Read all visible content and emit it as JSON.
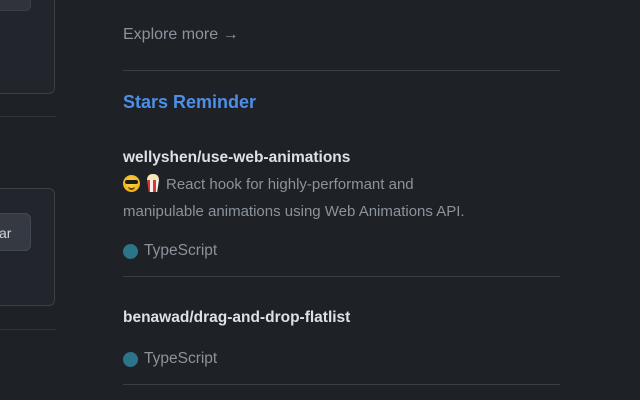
{
  "left": {
    "button_partial_label": "ar"
  },
  "main": {
    "explore_label": "Explore more →",
    "section_title": "Stars Reminder",
    "repos": [
      {
        "name": "wellyshen/use-web-animations",
        "emoji": [
          "sunglasses-face-emoji",
          "popcorn-emoji"
        ],
        "description_line1": "React hook for highly-performant and",
        "description_line2": "manipulable animations using Web Animations API.",
        "language": "TypeScript",
        "language_color": "#2b7489"
      },
      {
        "name": "benawad/drag-and-drop-flatlist",
        "description_line1": "",
        "description_line2": "",
        "language": "TypeScript",
        "language_color": "#2b7489"
      }
    ]
  },
  "colors": {
    "background": "#1e2126",
    "accent": "#4d8fe6",
    "muted_text": "#8b939c",
    "primary_text": "#dde1e6"
  }
}
